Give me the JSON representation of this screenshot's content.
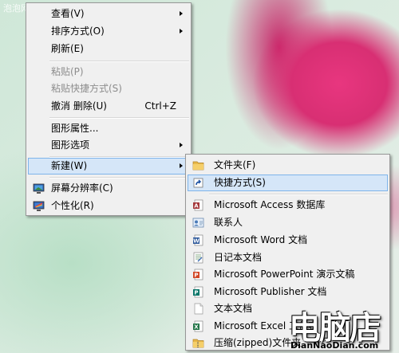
{
  "watermark": "泡泡网 PCPOP.COM",
  "context_menu": {
    "items": [
      {
        "label": "查看(V)",
        "submenu": true
      },
      {
        "label": "排序方式(O)",
        "submenu": true
      },
      {
        "label": "刷新(E)"
      },
      {
        "label": "粘贴(P)",
        "disabled": true
      },
      {
        "label": "粘贴快捷方式(S)",
        "disabled": true
      },
      {
        "label": "撤消 删除(U)",
        "shortcut": "Ctrl+Z"
      },
      {
        "label": "图形属性..."
      },
      {
        "label": "图形选项",
        "submenu": true
      },
      {
        "label": "新建(W)",
        "submenu": true,
        "highlighted": true
      },
      {
        "label": "屏幕分辨率(C)",
        "icon": "display-icon"
      },
      {
        "label": "个性化(R)",
        "icon": "personalize-icon"
      }
    ]
  },
  "new_submenu": {
    "items": [
      {
        "label": "文件夹(F)",
        "icon": "folder-icon"
      },
      {
        "label": "快捷方式(S)",
        "icon": "shortcut-icon",
        "highlighted": true
      },
      {
        "label": "Microsoft Access 数据库",
        "icon": "access-icon"
      },
      {
        "label": "联系人",
        "icon": "contact-icon"
      },
      {
        "label": "Microsoft Word 文档",
        "icon": "word-icon"
      },
      {
        "label": "日记本文档",
        "icon": "journal-icon"
      },
      {
        "label": "Microsoft PowerPoint 演示文稿",
        "icon": "powerpoint-icon"
      },
      {
        "label": "Microsoft Publisher 文档",
        "icon": "publisher-icon"
      },
      {
        "label": "文本文档",
        "icon": "text-document-icon"
      },
      {
        "label": "Microsoft Excel 工作表",
        "icon": "excel-icon"
      },
      {
        "label": "压缩(zipped)文件夹",
        "icon": "zip-folder-icon"
      }
    ]
  },
  "logo": {
    "main": "电脑店",
    "sub": "DianNaoDian.com"
  },
  "colors": {
    "highlight": "#d5e6f8",
    "highlight_border": "#7eb4ea",
    "menu_bg": "#f0f0f0"
  }
}
